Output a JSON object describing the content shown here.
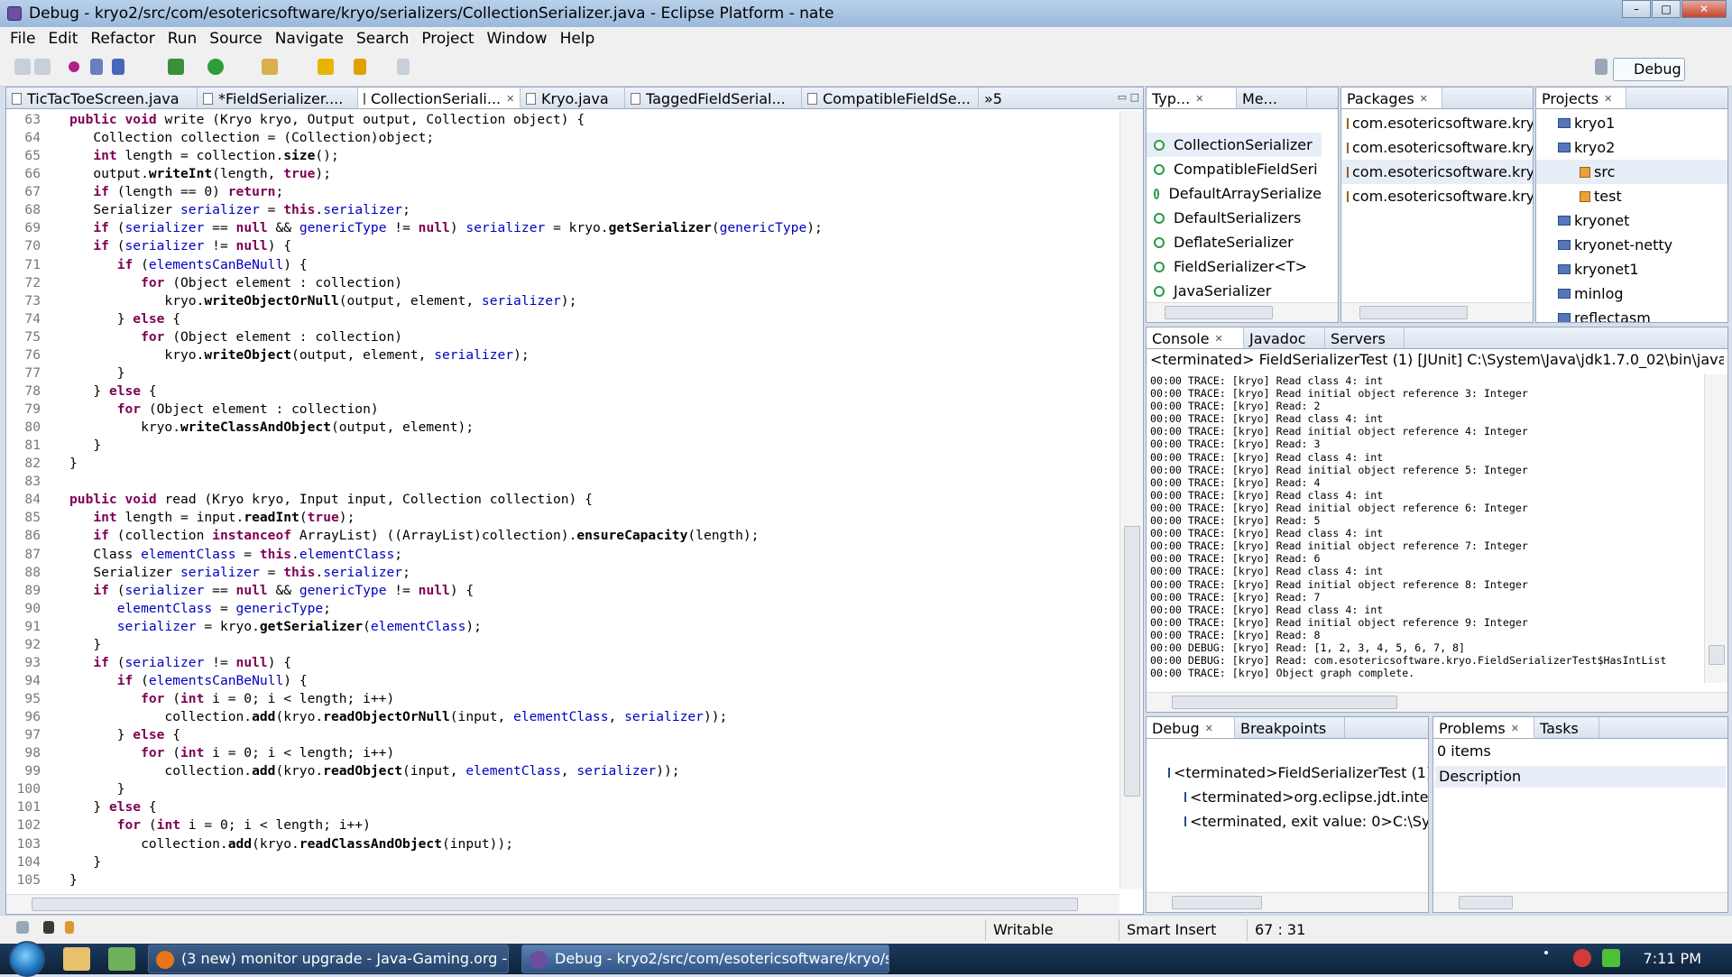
{
  "window": {
    "title": "Debug - kryo2/src/com/esotericsoftware/kryo/serializers/CollectionSerializer.java - Eclipse Platform - nate"
  },
  "menu": [
    "File",
    "Edit",
    "Refactor",
    "Run",
    "Source",
    "Navigate",
    "Search",
    "Project",
    "Window",
    "Help"
  ],
  "toolbar": {
    "perspective_label": "Debug"
  },
  "editor": {
    "tabs": [
      "TicTacToeScreen.java",
      "*FieldSerializer....",
      "CollectionSeriali...",
      "Kryo.java",
      "TaggedFieldSerial...",
      "CompatibleFieldSe...",
      "»5"
    ],
    "active_tab": 2
  },
  "type_view": {
    "tabs": [
      "Typ...",
      "Me..."
    ],
    "items": [
      "CollectionSerializer",
      "CompatibleFieldSeri",
      "DefaultArraySerialize",
      "DefaultSerializers",
      "DeflateSerializer",
      "FieldSerializer<T>",
      "JavaSerializer"
    ]
  },
  "packages": {
    "tab": "Packages",
    "items": [
      "com.esotericsoftware.kry",
      "com.esotericsoftware.kry",
      "com.esotericsoftware.kry",
      "com.esotericsoftware.kry"
    ]
  },
  "projects": {
    "tab": "Projects",
    "items": [
      "kryo1",
      "kryo2",
      "src",
      "test",
      "kryonet",
      "kryonet-netty",
      "kryonet1",
      "minlog",
      "reflectasm"
    ]
  },
  "console": {
    "tabs": [
      "Console",
      "Javadoc",
      "Servers"
    ],
    "header": "<terminated> FieldSerializerTest (1) [JUnit] C:\\System\\Java\\jdk1.7.0_02\\bin\\javaw.exe",
    "lines": [
      "00:00 TRACE: [kryo] Read class 4: int",
      "00:00 TRACE: [kryo] Read initial object reference 3: Integer",
      "00:00 TRACE: [kryo] Read: 2",
      "00:00 TRACE: [kryo] Read class 4: int",
      "00:00 TRACE: [kryo] Read initial object reference 4: Integer",
      "00:00 TRACE: [kryo] Read: 3",
      "00:00 TRACE: [kryo] Read class 4: int",
      "00:00 TRACE: [kryo] Read initial object reference 5: Integer",
      "00:00 TRACE: [kryo] Read: 4",
      "00:00 TRACE: [kryo] Read class 4: int",
      "00:00 TRACE: [kryo] Read initial object reference 6: Integer",
      "00:00 TRACE: [kryo] Read: 5",
      "00:00 TRACE: [kryo] Read class 4: int",
      "00:00 TRACE: [kryo] Read initial object reference 7: Integer",
      "00:00 TRACE: [kryo] Read: 6",
      "00:00 TRACE: [kryo] Read class 4: int",
      "00:00 TRACE: [kryo] Read initial object reference 8: Integer",
      "00:00 TRACE: [kryo] Read: 7",
      "00:00 TRACE: [kryo] Read class 4: int",
      "00:00 TRACE: [kryo] Read initial object reference 9: Integer",
      "00:00 TRACE: [kryo] Read: 8",
      "00:00 DEBUG: [kryo] Read: [1, 2, 3, 4, 5, 6, 7, 8]",
      "00:00 DEBUG: [kryo] Read: com.esotericsoftware.kryo.FieldSerializerTest$HasIntList",
      "00:00 TRACE: [kryo] Object graph complete."
    ]
  },
  "debug": {
    "tabs": [
      "Debug",
      "Breakpoints"
    ],
    "items": [
      "<terminated>FieldSerializerTest (1)",
      "<terminated>org.eclipse.jdt.inte",
      "<terminated, exit value: 0>C:\\Sy"
    ]
  },
  "problems": {
    "tabs": [
      "Problems",
      "Tasks"
    ],
    "count": "0 items",
    "column": "Description"
  },
  "status": {
    "writable": "Writable",
    "insert": "Smart Insert",
    "position": "67 : 31"
  },
  "taskbar": {
    "buttons": [
      "(3 new) monitor upgrade - Java-Gaming.org - ...",
      "Debug - kryo2/src/com/esotericsoftware/kryo/s..."
    ],
    "clock": "7:11 PM"
  },
  "code": [
    {
      "n": "63",
      "t": [
        [
          "",
          "public void write (Kryo kryo, Output output, Collection object) {"
        ]
      ]
    },
    {
      "n": "64",
      "t": [
        [
          "",
          "   Collection collection = (Collection)object;"
        ]
      ]
    },
    {
      "n": "65",
      "t": [
        [
          "",
          "   int length = collection.size();"
        ]
      ]
    },
    {
      "n": "66",
      "t": [
        [
          "",
          "   output.writeInt(length, true);"
        ]
      ]
    },
    {
      "n": "67",
      "t": [
        [
          "",
          "   if (length == 0) return;"
        ]
      ]
    },
    {
      "n": "68",
      "t": [
        [
          "",
          "   Serializer serializer = this.serializer;"
        ]
      ]
    },
    {
      "n": "69",
      "t": [
        [
          "",
          "   if (serializer == null && genericType != null) serializer = kryo.getSerializer(genericType);"
        ]
      ]
    },
    {
      "n": "70",
      "t": [
        [
          "",
          "   if (serializer != null) {"
        ]
      ]
    },
    {
      "n": "71",
      "t": [
        [
          "",
          "      if (elementsCanBeNull) {"
        ]
      ]
    },
    {
      "n": "72",
      "t": [
        [
          "",
          "         for (Object element : collection)"
        ]
      ]
    },
    {
      "n": "73",
      "t": [
        [
          "",
          "            kryo.writeObjectOrNull(output, element, serializer);"
        ]
      ]
    },
    {
      "n": "74",
      "t": [
        [
          "",
          "      } else {"
        ]
      ]
    },
    {
      "n": "75",
      "t": [
        [
          "",
          "         for (Object element : collection)"
        ]
      ]
    },
    {
      "n": "76",
      "t": [
        [
          "",
          "            kryo.writeObject(output, element, serializer);"
        ]
      ]
    },
    {
      "n": "77",
      "t": [
        [
          "",
          "      }"
        ]
      ]
    },
    {
      "n": "78",
      "t": [
        [
          "",
          "   } else {"
        ]
      ]
    },
    {
      "n": "79",
      "t": [
        [
          "",
          "      for (Object element : collection)"
        ]
      ]
    },
    {
      "n": "80",
      "t": [
        [
          "",
          "         kryo.writeClassAndObject(output, element);"
        ]
      ]
    },
    {
      "n": "81",
      "t": [
        [
          "",
          "   }"
        ]
      ]
    },
    {
      "n": "82",
      "t": [
        [
          "",
          "}"
        ]
      ]
    },
    {
      "n": "83",
      "t": [
        [
          "",
          ""
        ]
      ]
    },
    {
      "n": "84",
      "t": [
        [
          "",
          "public void read (Kryo kryo, Input input, Collection collection) {"
        ]
      ]
    },
    {
      "n": "85",
      "t": [
        [
          "",
          "   int length = input.readInt(true);"
        ]
      ]
    },
    {
      "n": "86",
      "t": [
        [
          "",
          "   if (collection instanceof ArrayList) ((ArrayList)collection).ensureCapacity(length);"
        ]
      ]
    },
    {
      "n": "87",
      "t": [
        [
          "",
          "   Class elementClass = this.elementClass;"
        ]
      ]
    },
    {
      "n": "88",
      "t": [
        [
          "",
          "   Serializer serializer = this.serializer;"
        ]
      ]
    },
    {
      "n": "89",
      "t": [
        [
          "",
          "   if (serializer == null && genericType != null) {"
        ]
      ]
    },
    {
      "n": "90",
      "t": [
        [
          "",
          "      elementClass = genericType;"
        ]
      ]
    },
    {
      "n": "91",
      "t": [
        [
          "",
          "      serializer = kryo.getSerializer(elementClass);"
        ]
      ]
    },
    {
      "n": "92",
      "t": [
        [
          "",
          "   }"
        ]
      ]
    },
    {
      "n": "93",
      "t": [
        [
          "",
          "   if (serializer != null) {"
        ]
      ]
    },
    {
      "n": "94",
      "t": [
        [
          "",
          "      if (elementsCanBeNull) {"
        ]
      ]
    },
    {
      "n": "95",
      "t": [
        [
          "",
          "         for (int i = 0; i < length; i++)"
        ]
      ]
    },
    {
      "n": "96",
      "t": [
        [
          "",
          "            collection.add(kryo.readObjectOrNull(input, elementClass, serializer));"
        ]
      ]
    },
    {
      "n": "97",
      "t": [
        [
          "",
          "      } else {"
        ]
      ]
    },
    {
      "n": "98",
      "t": [
        [
          "",
          "         for (int i = 0; i < length; i++)"
        ]
      ]
    },
    {
      "n": "99",
      "t": [
        [
          "",
          "            collection.add(kryo.readObject(input, elementClass, serializer));"
        ]
      ]
    },
    {
      "n": "100",
      "t": [
        [
          "",
          "      }"
        ]
      ]
    },
    {
      "n": "101",
      "t": [
        [
          "",
          "   } else {"
        ]
      ]
    },
    {
      "n": "102",
      "t": [
        [
          "",
          "      for (int i = 0; i < length; i++)"
        ]
      ]
    },
    {
      "n": "103",
      "t": [
        [
          "",
          "         collection.add(kryo.readClassAndObject(input));"
        ]
      ]
    },
    {
      "n": "104",
      "t": [
        [
          "",
          "   }"
        ]
      ]
    },
    {
      "n": "105",
      "t": [
        [
          "",
          "}"
        ]
      ]
    }
  ]
}
